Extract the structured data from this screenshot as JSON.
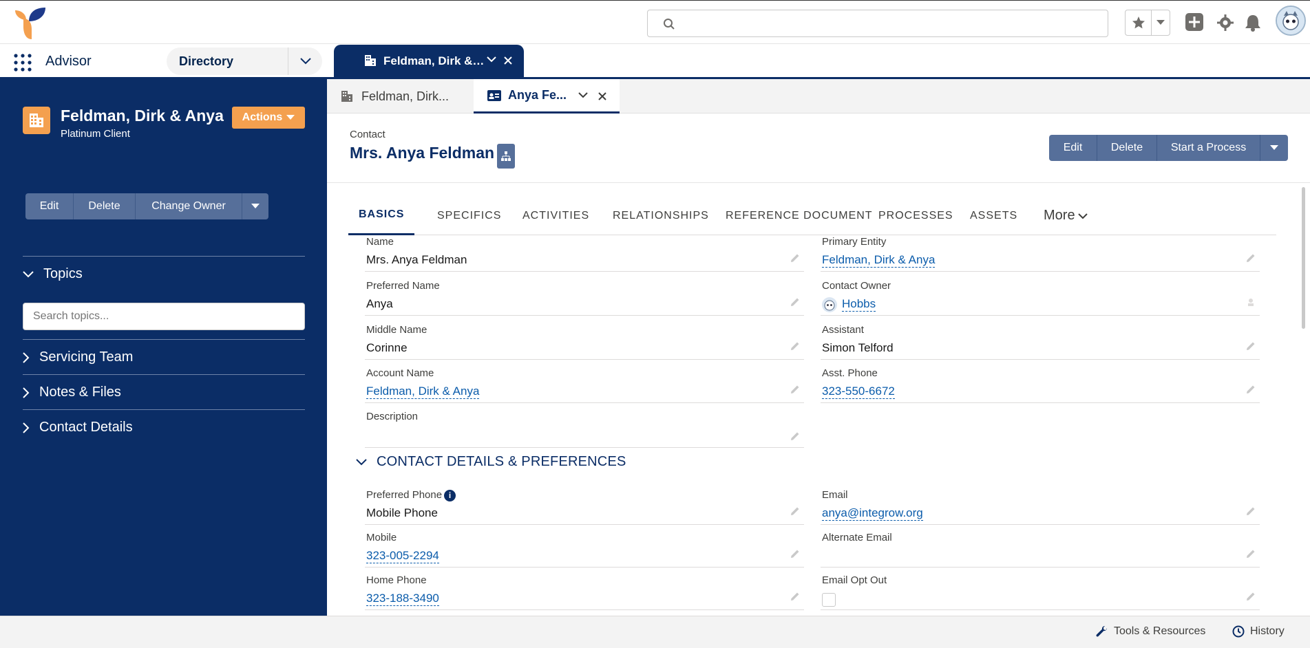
{
  "global_header": {
    "search_placeholder": "",
    "icons": [
      "app-logo",
      "search-icon",
      "star-icon",
      "chevron-down-icon",
      "add-icon",
      "gear-icon",
      "bell-icon",
      "user-avatar"
    ]
  },
  "nav": {
    "app_name": "Advisor",
    "select_label": "Directory",
    "workspace_tab_label": "Feldman, Dirk & A..."
  },
  "sidebar": {
    "entity_title": "Feldman, Dirk & Anya",
    "entity_subtitle": "Platinum Client",
    "actions_label": "Actions",
    "buttons": {
      "edit": "Edit",
      "delete": "Delete",
      "change_owner": "Change Owner"
    },
    "topics_label": "Topics",
    "topics_placeholder": "Search topics...",
    "sections": [
      "Servicing Team",
      "Notes & Files",
      "Contact Details"
    ]
  },
  "subtabs": {
    "tab1": "Feldman, Dirk...",
    "tab2": "Anya Fe..."
  },
  "record": {
    "object_label": "Contact",
    "title": "Mrs. Anya Feldman",
    "buttons": {
      "edit": "Edit",
      "delete": "Delete",
      "start_process": "Start a Process"
    }
  },
  "tabs": [
    "BASICS",
    "SPECIFICS",
    "ACTIVITIES",
    "RELATIONSHIPS",
    "REFERENCE DOCUMENT",
    "PROCESSES",
    "ASSETS"
  ],
  "tabs_more": "More",
  "basics": {
    "name_label": "Name",
    "name_value": "Mrs. Anya Feldman",
    "primary_entity_label": "Primary Entity",
    "primary_entity_value": "Feldman, Dirk & Anya",
    "preferred_name_label": "Preferred Name",
    "preferred_name_value": "Anya",
    "contact_owner_label": "Contact Owner",
    "contact_owner_value": "Hobbs",
    "middle_name_label": "Middle Name",
    "middle_name_value": "Corinne",
    "assistant_label": "Assistant",
    "assistant_value": "Simon Telford",
    "account_name_label": "Account Name",
    "account_name_value": "Feldman, Dirk & Anya",
    "asst_phone_label": "Asst. Phone",
    "asst_phone_value": "323-550-6672",
    "description_label": "Description",
    "description_value": ""
  },
  "contact_section": {
    "heading": "CONTACT DETAILS & PREFERENCES",
    "preferred_phone_label": "Preferred Phone",
    "preferred_phone_value": "Mobile Phone",
    "email_label": "Email",
    "email_value": "anya@integrow.org",
    "mobile_label": "Mobile",
    "mobile_value": "323-005-2294",
    "alt_email_label": "Alternate Email",
    "alt_email_value": "",
    "home_phone_label": "Home Phone",
    "home_phone_value": "323-188-3490",
    "email_opt_out_label": "Email Opt Out",
    "email_opt_out_checked": false
  },
  "utility": {
    "tools_label": "Tools & Resources",
    "history_label": "History"
  },
  "colors": {
    "navy": "#0b2d66",
    "button_slate": "#566f9a",
    "accent_orange": "#f4a04f",
    "link_blue": "#0b5cab"
  }
}
